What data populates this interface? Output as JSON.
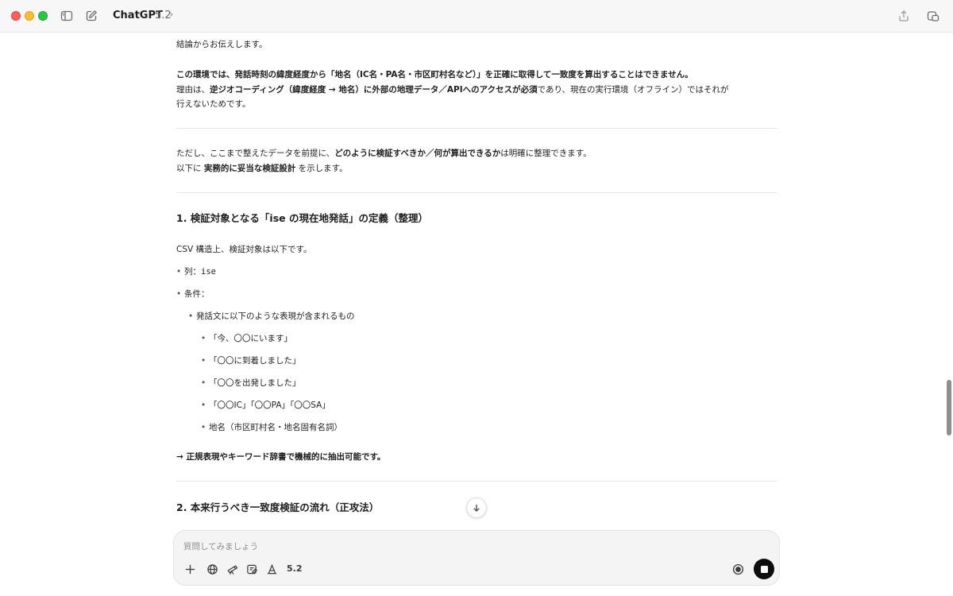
{
  "titlebar": {
    "app_name": "ChatGPT",
    "model_version": "5.2",
    "chevron": "›",
    "icons": [
      "sidebar-toggle-icon",
      "new-chat-icon",
      "share-icon",
      "window-icon"
    ]
  },
  "message": {
    "p1": "結論からお伝えします。",
    "p2_bold": "この環境では、発話時刻の緯度経度から「地名（IC名・PA名・市区町村名など）」を正確に取得して一致度を算出することはできません。",
    "p3_a": "理由は、",
    "p3_b": "逆ジオコーディング（緯度経度 → 地名）に外部の地理データ／APIへのアクセスが必須",
    "p3_c": "であり、現在の実行環境（オフライン）ではそれが",
    "p3_line2": "行えないためです。",
    "p4_a": "ただし、ここまで整えたデータを前提に、",
    "p4_b": "どのように検証すべきか／何が算出できるか",
    "p4_c": "は明確に整理できます。",
    "p5_a": "以下に ",
    "p5_b": "実務的に妥当な検証設計",
    "p5_c": " を示します。",
    "h1": "1. 検証対象となる「ise の現在地発話」の定義（整理）",
    "csv_intro": "CSV 構造上、検証対象は以下です。",
    "bullet_col_label": "列：",
    "bullet_col_value": "ise",
    "bullet_cond": "条件：",
    "sub_bullet": "発話文に以下のような表現が含まれるもの",
    "examples": [
      "「今、〇〇にいます」",
      "「〇〇に到着しました」",
      "「〇〇を出発しました」",
      "「〇〇IC」「〇〇PA」「〇〇SA」",
      "地名（市区町村名・地名固有名詞）"
    ],
    "conclusion": "→ 正規表現やキーワード辞書で機械的に抽出可能です。",
    "h2": "2. 本来行うべき一致度検証の流れ（正攻法）"
  },
  "composer": {
    "placeholder": "質問してみましょう",
    "model_label": "5.2",
    "tools": [
      "plus-icon",
      "globe-icon",
      "telescope-icon",
      "canvas-icon",
      "style-icon"
    ]
  },
  "colors": {
    "accent": "#0d0d0d",
    "close": "#ff5f57",
    "minimize": "#febc2e",
    "maximize": "#28c840"
  }
}
